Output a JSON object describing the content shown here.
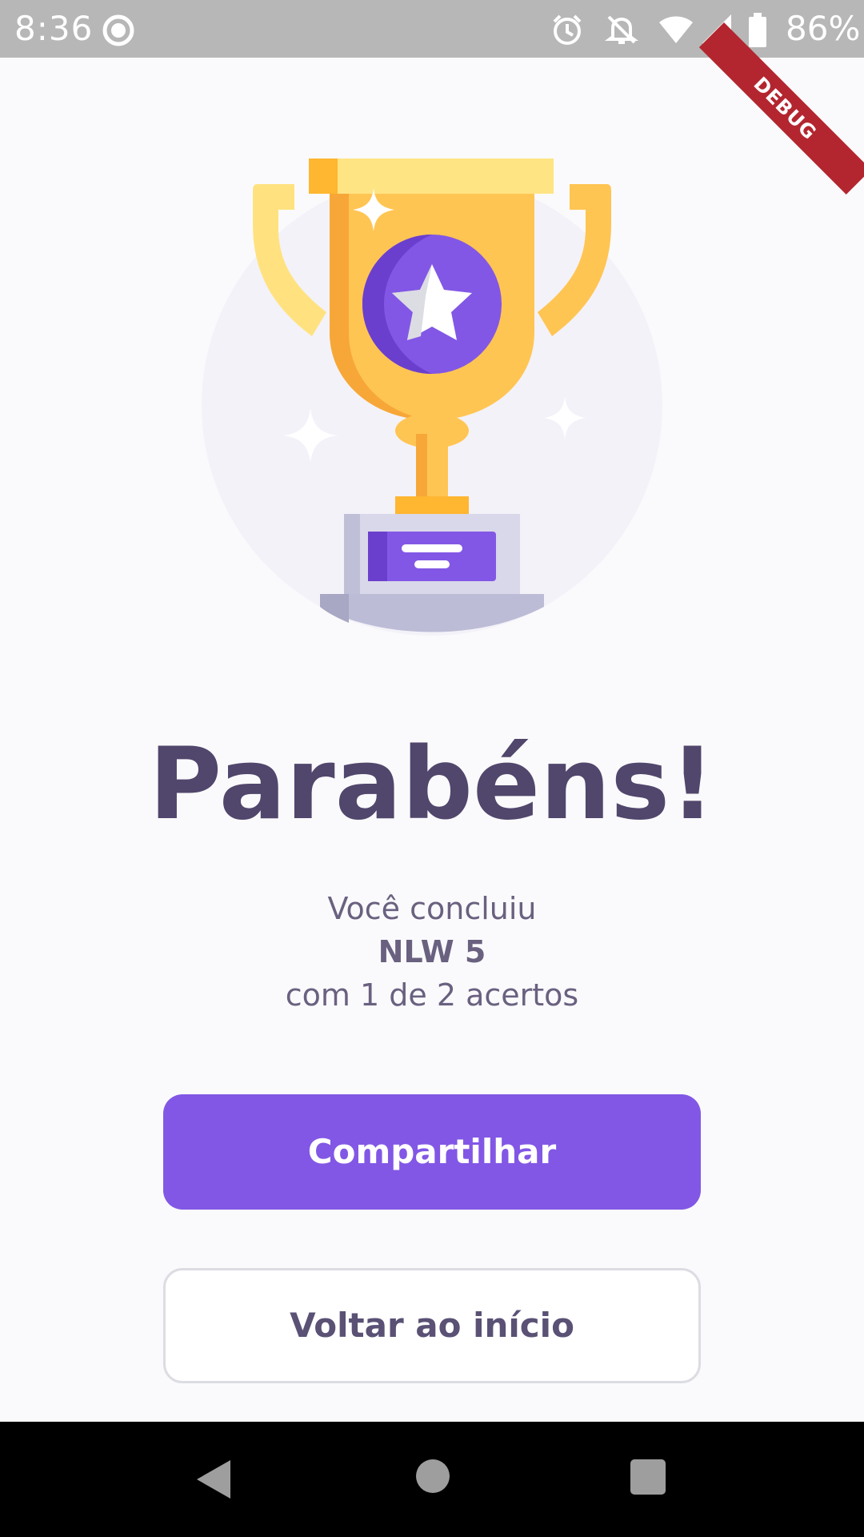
{
  "status_bar": {
    "time": "8:36",
    "battery": "86%",
    "icons": [
      "data-saver-icon",
      "alarm-icon",
      "notifications-off-icon",
      "wifi-icon",
      "signal-icon",
      "battery-icon"
    ]
  },
  "debug_banner": "DEBUG",
  "result": {
    "title": "Parabéns!",
    "line1": "Você concluiu",
    "quiz_name": "NLW 5",
    "line3": "com 1 de 2 acertos"
  },
  "actions": {
    "share_label": "Compartilhar",
    "back_label": "Voltar ao início"
  },
  "nav_bar": {
    "icons": [
      "back-icon",
      "home-icon",
      "recents-icon"
    ]
  },
  "colors": {
    "primary": "#8257E5",
    "title": "#51466C",
    "text": "#6A6180",
    "background": "#FAFAFC",
    "status_bar": "#B7B7B7",
    "trophy_gold": "#FFC553",
    "debug_banner": "#B3262F"
  }
}
